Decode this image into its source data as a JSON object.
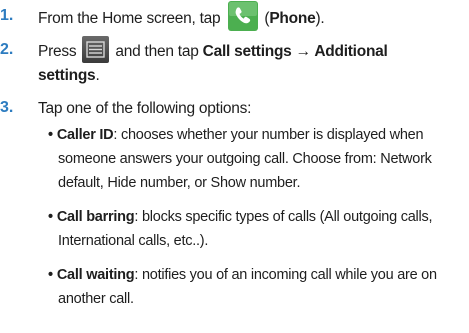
{
  "steps": [
    {
      "number": "1.",
      "text_before": "From the Home screen, tap",
      "icon": "phone-icon",
      "text_after_paren_open": "(",
      "bold": "Phone",
      "text_after_paren_close": ")."
    },
    {
      "number": "2.",
      "text_before": "Press",
      "icon": "menu-icon",
      "text_mid": "and then tap",
      "bold_1": "Call settings → Additional",
      "bold_2": "settings",
      "text_end": "."
    },
    {
      "number": "3.",
      "text": "Tap one of the following options:"
    }
  ],
  "options": [
    {
      "label": "Caller ID",
      "lines": [
        ": chooses whether your number is displayed when",
        "someone answers your outgoing call. Choose from: Network",
        "default, Hide number, or Show number."
      ]
    },
    {
      "label": "Call barring",
      "lines": [
        ": blocks specific types of calls (All outgoing calls,",
        "International calls, etc..)."
      ]
    },
    {
      "label": "Call waiting",
      "lines": [
        ": notifies you of an incoming call while you are on",
        "another call."
      ]
    }
  ],
  "bullet": "•",
  "colors": {
    "accent": "#2d7cc0",
    "phone_icon_bg": "#4caf50"
  }
}
